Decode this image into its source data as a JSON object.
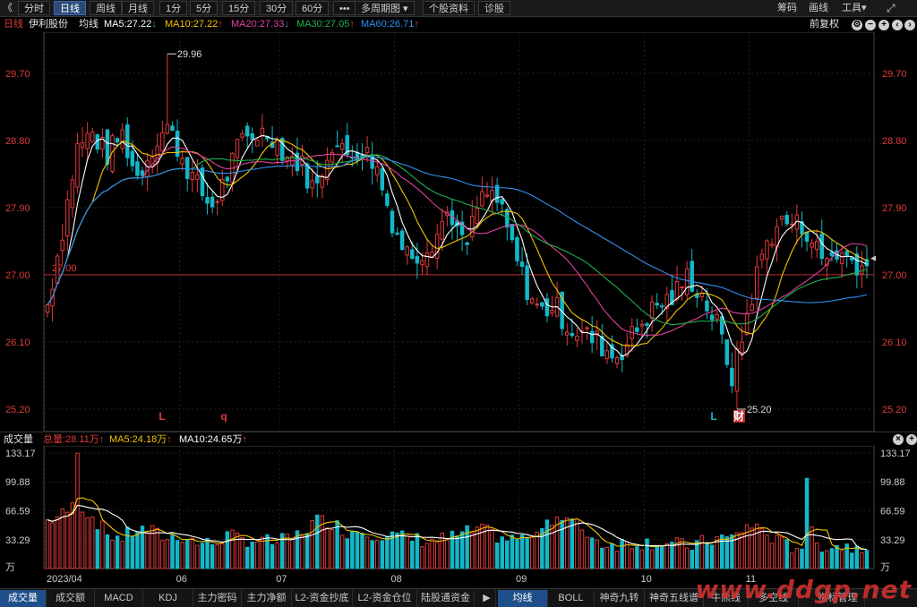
{
  "toolbar": {
    "back_glyph": "《",
    "buttons": [
      "分时",
      "日线",
      "周线",
      "月线",
      "1分",
      "5分",
      "15分",
      "30分",
      "60分",
      "•••",
      "多周期图",
      "个股资料",
      "诊股"
    ],
    "active": "日线",
    "right": [
      "筹码",
      "画线",
      "工具"
    ],
    "tools_arrow": "▾"
  },
  "legend": {
    "period": "日线",
    "stock_name": "伊利股份",
    "indicator": "均线",
    "ma": [
      {
        "label": "MA5:27.22",
        "arrow": "↓",
        "color": "#ffffff"
      },
      {
        "label": "MA10:27.22",
        "arrow": "↑",
        "color": "#f0c400"
      },
      {
        "label": "MA20:27.33",
        "arrow": "↓",
        "color": "#e040a0"
      },
      {
        "label": "MA30:27.05",
        "arrow": "↑",
        "color": "#20b050"
      },
      {
        "label": "MA60:26.71",
        "arrow": "↑",
        "color": "#2f8ff0"
      }
    ],
    "adjust": "前复权"
  },
  "volume_legend": {
    "title": "成交量",
    "total": "总量:28.11万",
    "total_arrow": "↑",
    "ma5": "MA5:24.18万",
    "ma5_arrow": "↑",
    "ma10": "MA10:24.65万",
    "ma10_arrow": "↑"
  },
  "colors": {
    "up": "#e03a3a",
    "down": "#13b8c8",
    "ma5": "#ffffff",
    "ma10": "#f0c400",
    "ma20": "#e040a0",
    "ma30": "#20b050",
    "ma60": "#2f8ff0",
    "price_axis": "#e03a3a",
    "ref_line": "#c02828"
  },
  "chart_data": {
    "type": "candlestick",
    "x_axis_labels": [
      "2023/04",
      "06",
      "07",
      "08",
      "09",
      "10",
      "11"
    ],
    "y_axis_labels": [
      "29.70",
      "28.80",
      "27.90",
      "27.00",
      "26.10",
      "25.20"
    ],
    "ylim": [
      24.9,
      30.25
    ],
    "reference_price": 27.0,
    "reference_label": "27.00",
    "high_marker": {
      "label": "29.96",
      "value": 29.96
    },
    "low_marker": {
      "label": "25.20",
      "value": 25.2
    },
    "event_markers": [
      {
        "label": "L",
        "color": "#e03a3a"
      },
      {
        "label": "q",
        "color": "#e03a3a"
      },
      {
        "label": "L",
        "color": "#13b8c8"
      },
      {
        "label": "财",
        "color": "#ffffff",
        "bg": "#c02828"
      }
    ],
    "volume_axis_labels": [
      "133.17",
      "99.88",
      "66.59",
      "33.29",
      "万"
    ],
    "volume_ylim": [
      0,
      133.17
    ],
    "volume_unit": "万",
    "anchor_closes": [
      26.6,
      27.6,
      28.7,
      28.9,
      28.6,
      28.9,
      28.3,
      28.7,
      29.0,
      28.6,
      28.2,
      27.9,
      28.3,
      28.8,
      28.9,
      28.9,
      28.6,
      28.5,
      28.1,
      28.8,
      28.6,
      28.7,
      28.5,
      27.8,
      27.3,
      27.3,
      27.5,
      27.9,
      27.3,
      28.0,
      28.1,
      27.5,
      26.9,
      26.5,
      26.6,
      26.3,
      26.2,
      26.1,
      25.9,
      26.1,
      26.4,
      26.6,
      26.7,
      27.0,
      26.7,
      26.3,
      25.6,
      26.5,
      27.3,
      27.7,
      27.7,
      27.6,
      27.2,
      27.3,
      27.2,
      27.1
    ],
    "volume_anchors": [
      55,
      62,
      75,
      60,
      40,
      35,
      45,
      42,
      35,
      38,
      30,
      28,
      38,
      33,
      33,
      30,
      32,
      40,
      55,
      55,
      42,
      45,
      40,
      38,
      35,
      33,
      32,
      35,
      40,
      45,
      38,
      33,
      35,
      50,
      60,
      55,
      45,
      30,
      28,
      30,
      30,
      30,
      28,
      25,
      30,
      35,
      35,
      50,
      45,
      30,
      25,
      28,
      27,
      26,
      25,
      28
    ]
  },
  "tabs": {
    "left": [
      "成交量",
      "成交额",
      "MACD",
      "KDJ",
      "主力密码",
      "主力净额",
      "L2-资金抄底",
      "L2-资金仓位",
      "陆股通资金"
    ],
    "left_active": "成交量",
    "next_glyph": "▶",
    "right": [
      "均线",
      "BOLL",
      "神奇九转",
      "神奇五线谱",
      "牛熊线",
      "多空线",
      "指标管理"
    ],
    "right_active": "均线"
  },
  "watermark": "www.ddgp.net"
}
